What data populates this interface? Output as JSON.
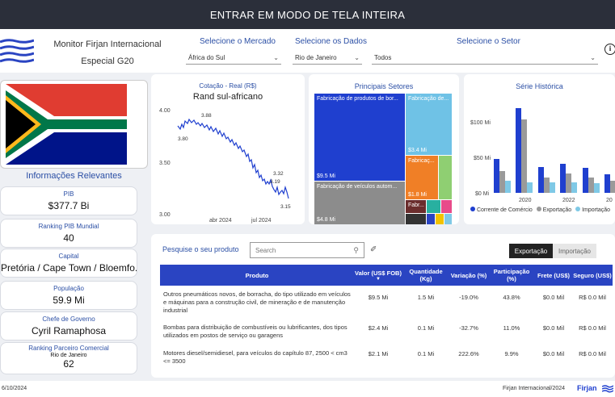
{
  "topbar": {
    "label": "ENTRAR EM MODO DE TELA INTEIRA"
  },
  "header": {
    "title": "Monitor Firjan Internacional",
    "subtitle": "Especial G20",
    "filters": [
      {
        "label": "Selecione o Mercado",
        "value": "África do Sul"
      },
      {
        "label": "Selecione os Dados",
        "value": "Rio de Janeiro"
      },
      {
        "label": "Selecione o Setor",
        "value": "Todos"
      }
    ]
  },
  "info": {
    "title": "Informações Relevantes",
    "kpis": [
      {
        "label": "PIB",
        "value": "$377.7 Bi"
      },
      {
        "label": "Ranking PIB Mundial",
        "value": "40"
      },
      {
        "label": "Capital",
        "value": "Pretória / Cape Town / Bloemfo..."
      },
      {
        "label": "População",
        "value": "59.9 Mi"
      },
      {
        "label": "Chefe de Governo",
        "value": "Cyril Ramaphosa"
      },
      {
        "label": "Ranking Parceiro Comercial",
        "sub": "Rio de Janeiro",
        "value": "62"
      }
    ]
  },
  "currency": {
    "caption": "Cotação - Real (R$)",
    "title": "Rand sul-africano",
    "yticks": [
      "4.00",
      "3.50",
      "3.00"
    ],
    "xticks": [
      "abr 2024",
      "jul 2024"
    ],
    "annotations": [
      "3.88",
      "3.80",
      "3.32",
      "3.19",
      "3.15"
    ]
  },
  "sectors": {
    "title": "Principais Setores",
    "cells": [
      {
        "label": "Fabricação de produtos de bor...",
        "value": "$9.5 Mi",
        "color": "#1f3fcf"
      },
      {
        "label": "Fabricação de...",
        "value": "$3.4 Mi",
        "color": "#6fc2e6"
      },
      {
        "label": "Fabricação de veículos autom...",
        "value": "$4.8 Mi",
        "color": "#8c8c8c"
      },
      {
        "label": "Fabricaç...",
        "value": "$1.8 Mi",
        "color": "#f07f26"
      },
      {
        "label": "Fabr...",
        "value": "",
        "color": "#6b2d2d"
      }
    ]
  },
  "history": {
    "title": "Série Histórica",
    "yticks": [
      "$100 Mi",
      "$50 Mi",
      "$0 Mi"
    ],
    "xticks": [
      "2020",
      "2022",
      "20"
    ],
    "legend": [
      {
        "name": "Corrente de Comércio",
        "color": "#1f3fcf"
      },
      {
        "name": "Exportação",
        "color": "#9a9a9a"
      },
      {
        "name": "Importação",
        "color": "#7fc9e6"
      }
    ]
  },
  "search": {
    "label": "Pesquise o seu produto",
    "placeholder": "Search",
    "tab_export": "Exportação",
    "tab_import": "Importação"
  },
  "table": {
    "headers": [
      "Produto",
      "Valor (US$ FOB)",
      "Quantidade (Kg)",
      "Variação (%)",
      "Participação (%)",
      "Frete (US$)",
      "Seguro (US$)"
    ],
    "rows": [
      [
        "Outros pneumáticos novos, de borracha, do tipo utilizado em veículos e máquinas para a construção civil, de mineração e de manutenção industrial",
        "$9.5 Mi",
        "1.5 Mi",
        "-19.0%",
        "43.8%",
        "$0.0 Mil",
        "R$ 0.0 Mil"
      ],
      [
        "Bombas para distribuição de combustíveis ou lubrificantes, dos tipos utilizados em postos de serviço ou garagens",
        "$2.4 Mi",
        "0.1 Mi",
        "-32.7%",
        "11.0%",
        "$0.0 Mil",
        "R$ 0.0 Mil"
      ],
      [
        "Motores diesel/semidiesel, para veículos do capítulo 87, 2500 < cm3 <= 3500",
        "$2.1 Mi",
        "0.1 Mi",
        "222.6%",
        "9.9%",
        "$0.0 Mil",
        "R$ 0.0 Mil"
      ]
    ]
  },
  "footer": {
    "date": "6/10/2024",
    "credit": "Firjan Internacional/2024",
    "brand": "Firjan"
  }
}
